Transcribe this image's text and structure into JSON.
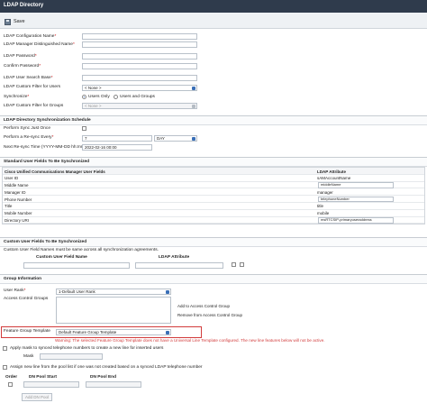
{
  "window": {
    "title": "LDAP Directory"
  },
  "toolbar": {
    "save_label": "Save"
  },
  "top_fields": [
    {
      "label": "LDAP Configuration Name",
      "required": true,
      "value": ""
    },
    {
      "label": "LDAP Manager Distinguished Name",
      "required": true,
      "value": ""
    },
    {
      "label": "LDAP Password",
      "required": true,
      "value": ""
    },
    {
      "label": "Confirm Password",
      "required": true,
      "value": ""
    },
    {
      "label": "LDAP User Search Base",
      "required": true,
      "value": ""
    },
    {
      "label": "LDAP Custom Filter for Users",
      "required": false,
      "value": "< None >"
    },
    {
      "label": "Synchronize",
      "required": true
    },
    {
      "label": "LDAP Custom Filter for Groups",
      "required": false,
      "value": "< None >"
    }
  ],
  "sync_radio": {
    "users_only": "Users Only",
    "users_groups": "Users and Groups"
  },
  "schedule": {
    "title": "LDAP Directory Synchronization Schedule",
    "perform_sync_label": "Perform Sync Just Once",
    "resync_label": "Perform a Re-sync Every",
    "resync_value": "7",
    "resync_unit": "DAY",
    "next_label": "Next Re-sync Time (YYYY-MM-DD hh:mm)",
    "next_value": "2022-02-16 00:00"
  },
  "standard": {
    "title": "Standard User Fields To Be Synchronized",
    "col1": "Cisco Unified Communications Manager User Fields",
    "col2": "LDAP Attribute",
    "rows": [
      {
        "field": "User ID",
        "attr": "sAMAccountName",
        "boxed": false
      },
      {
        "field": "Middle Name",
        "attr": "middleName",
        "boxed": true
      },
      {
        "field": "Manager ID",
        "attr": "manager",
        "boxed": false
      },
      {
        "field": "Phone Number",
        "attr": "telephoneNumber",
        "boxed": true
      },
      {
        "field": "Title",
        "attr": "title",
        "boxed": false
      },
      {
        "field": "Mobile Number",
        "attr": "mobile",
        "boxed": false
      },
      {
        "field": "Directory URI",
        "attr": "msRTCSIP-primaryuseraddress",
        "boxed": true
      }
    ]
  },
  "custom": {
    "title": "Custom User Fields To Be Synchronized",
    "note": "Custom User Field Names must be same across all synchronization agreements.",
    "col1": "Custom User Field Name",
    "col2": "LDAP Attribute"
  },
  "group": {
    "title": "Group Information",
    "user_rank_label": "User Rank",
    "user_rank_value": "1-Default User Rank",
    "acg_label": "Access Control Groups",
    "add_acg": "Add to Access Control Group",
    "remove_acg": "Remove from Access Control Group",
    "fgt_label": "Feature Group Template",
    "fgt_value": "Default Feature Group Template",
    "warning": "Warning: The selected Feature Group Template does not have a Universal Line Template configured. The new line features below will not be active.",
    "apply_mask": "Apply mask to synced telephone numbers to create a new line for inserted users",
    "mask_label": "Mask",
    "assign_line": "Assign new line from the pool list if one was not created based on a synced LDAP telephone number",
    "order": "Order",
    "dn_start": "DN Pool Start",
    "dn_end": "DN Pool End",
    "add_pool": "Add DN Pool"
  }
}
